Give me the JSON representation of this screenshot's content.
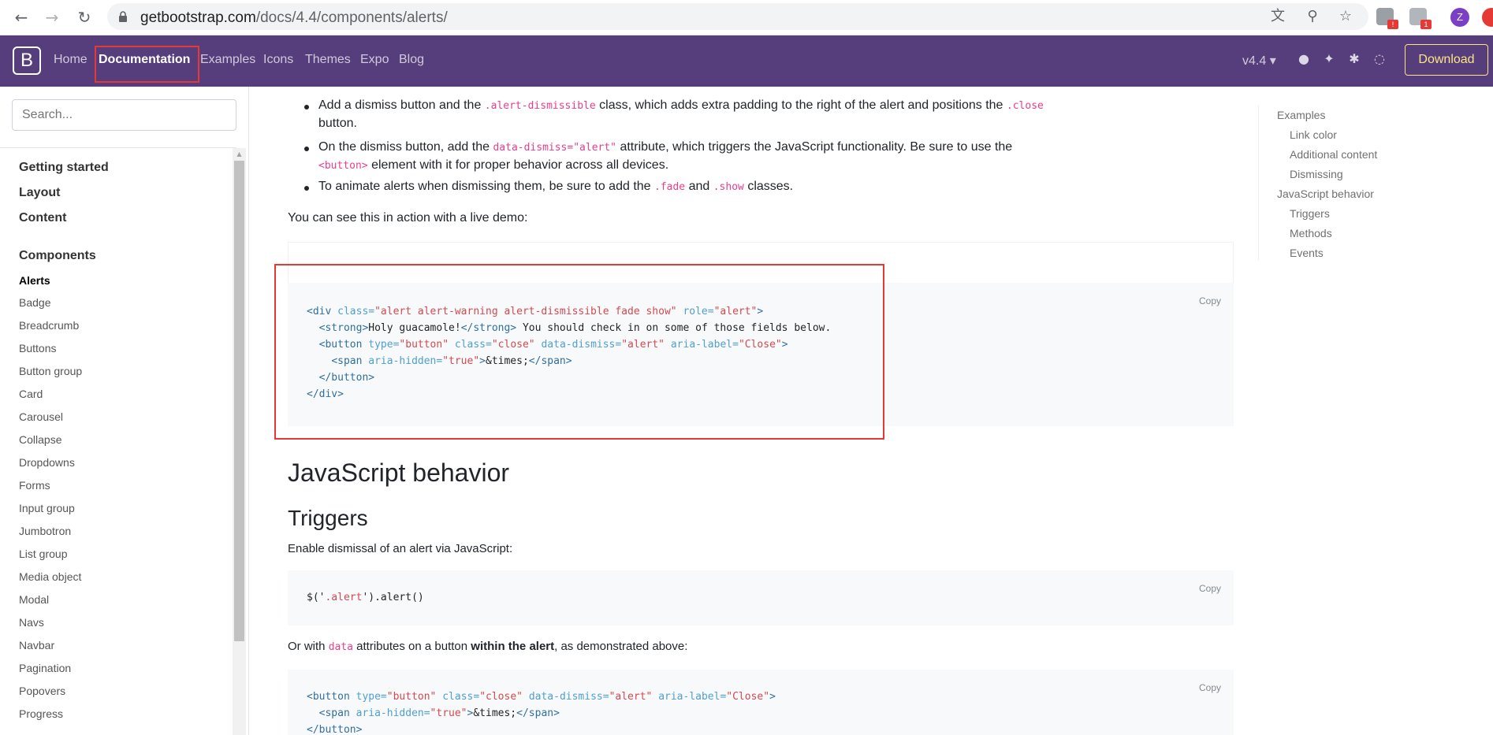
{
  "browser": {
    "url_host": "getbootstrap.com",
    "url_path": "/docs/4.4/components/alerts/",
    "ext_badge_1": "!",
    "ext_badge_2": "1",
    "profile_initial": "Z"
  },
  "navbar": {
    "brand": "B",
    "links": [
      "Home",
      "Documentation",
      "Examples",
      "Icons",
      "Themes",
      "Expo",
      "Blog"
    ],
    "active": "Documentation",
    "version": "v4.4 ▾",
    "download": "Download"
  },
  "sidebar": {
    "search_placeholder": "Search...",
    "sections": [
      "Getting started",
      "Layout",
      "Content",
      "Components"
    ],
    "items": [
      "Alerts",
      "Badge",
      "Breadcrumb",
      "Buttons",
      "Button group",
      "Card",
      "Carousel",
      "Collapse",
      "Dropdowns",
      "Forms",
      "Input group",
      "Jumbotron",
      "List group",
      "Media object",
      "Modal",
      "Navs",
      "Navbar",
      "Pagination",
      "Popovers",
      "Progress"
    ],
    "active_item": "Alerts"
  },
  "content": {
    "bullets": {
      "b1_pre": "Add a dismiss button and the ",
      "b1_code1": ".alert-dismissible",
      "b1_mid": " class, which adds extra padding to the right of the alert and positions the ",
      "b1_code2": ".close",
      "b1_end": "button.",
      "b2_pre": "On the dismiss button, add the ",
      "b2_code1": "data-dismiss=\"alert\"",
      "b2_mid": " attribute, which triggers the JavaScript functionality. Be sure to use the",
      "b2_code2": "<button>",
      "b2_end": " element with it for proper behavior across all devices.",
      "b3_pre": "To animate alerts when dismissing them, be sure to add the ",
      "b3_code1": ".fade",
      "b3_mid": " and ",
      "b3_code2": ".show",
      "b3_end": " classes."
    },
    "live_demo_text": "You can see this in action with a live demo:",
    "copy_label": "Copy",
    "h_js": "JavaScript behavior",
    "h_triggers": "Triggers",
    "triggers_text": "Enable dismissal of an alert via JavaScript:",
    "js_code_pre": "$('",
    "js_code_str": ".alert",
    "js_code_post": "').alert()",
    "or_with_1": "Or with ",
    "or_with_code": "data",
    "or_with_2": " attributes on a button ",
    "or_with_bold": "within the alert",
    "or_with_3": ", as demonstrated above:"
  },
  "toc": {
    "items": [
      {
        "label": "Examples",
        "level": 1
      },
      {
        "label": "Link color",
        "level": 2
      },
      {
        "label": "Additional content",
        "level": 2
      },
      {
        "label": "Dismissing",
        "level": 2
      },
      {
        "label": "JavaScript behavior",
        "level": 1
      },
      {
        "label": "Triggers",
        "level": 2
      },
      {
        "label": "Methods",
        "level": 2
      },
      {
        "label": "Events",
        "level": 2
      }
    ]
  },
  "colors": {
    "bootstrap_purple": "#563d7c",
    "highlight_red": "#e53935",
    "download_yellow": "#ffe484",
    "code_pink": "#e83e8c"
  }
}
